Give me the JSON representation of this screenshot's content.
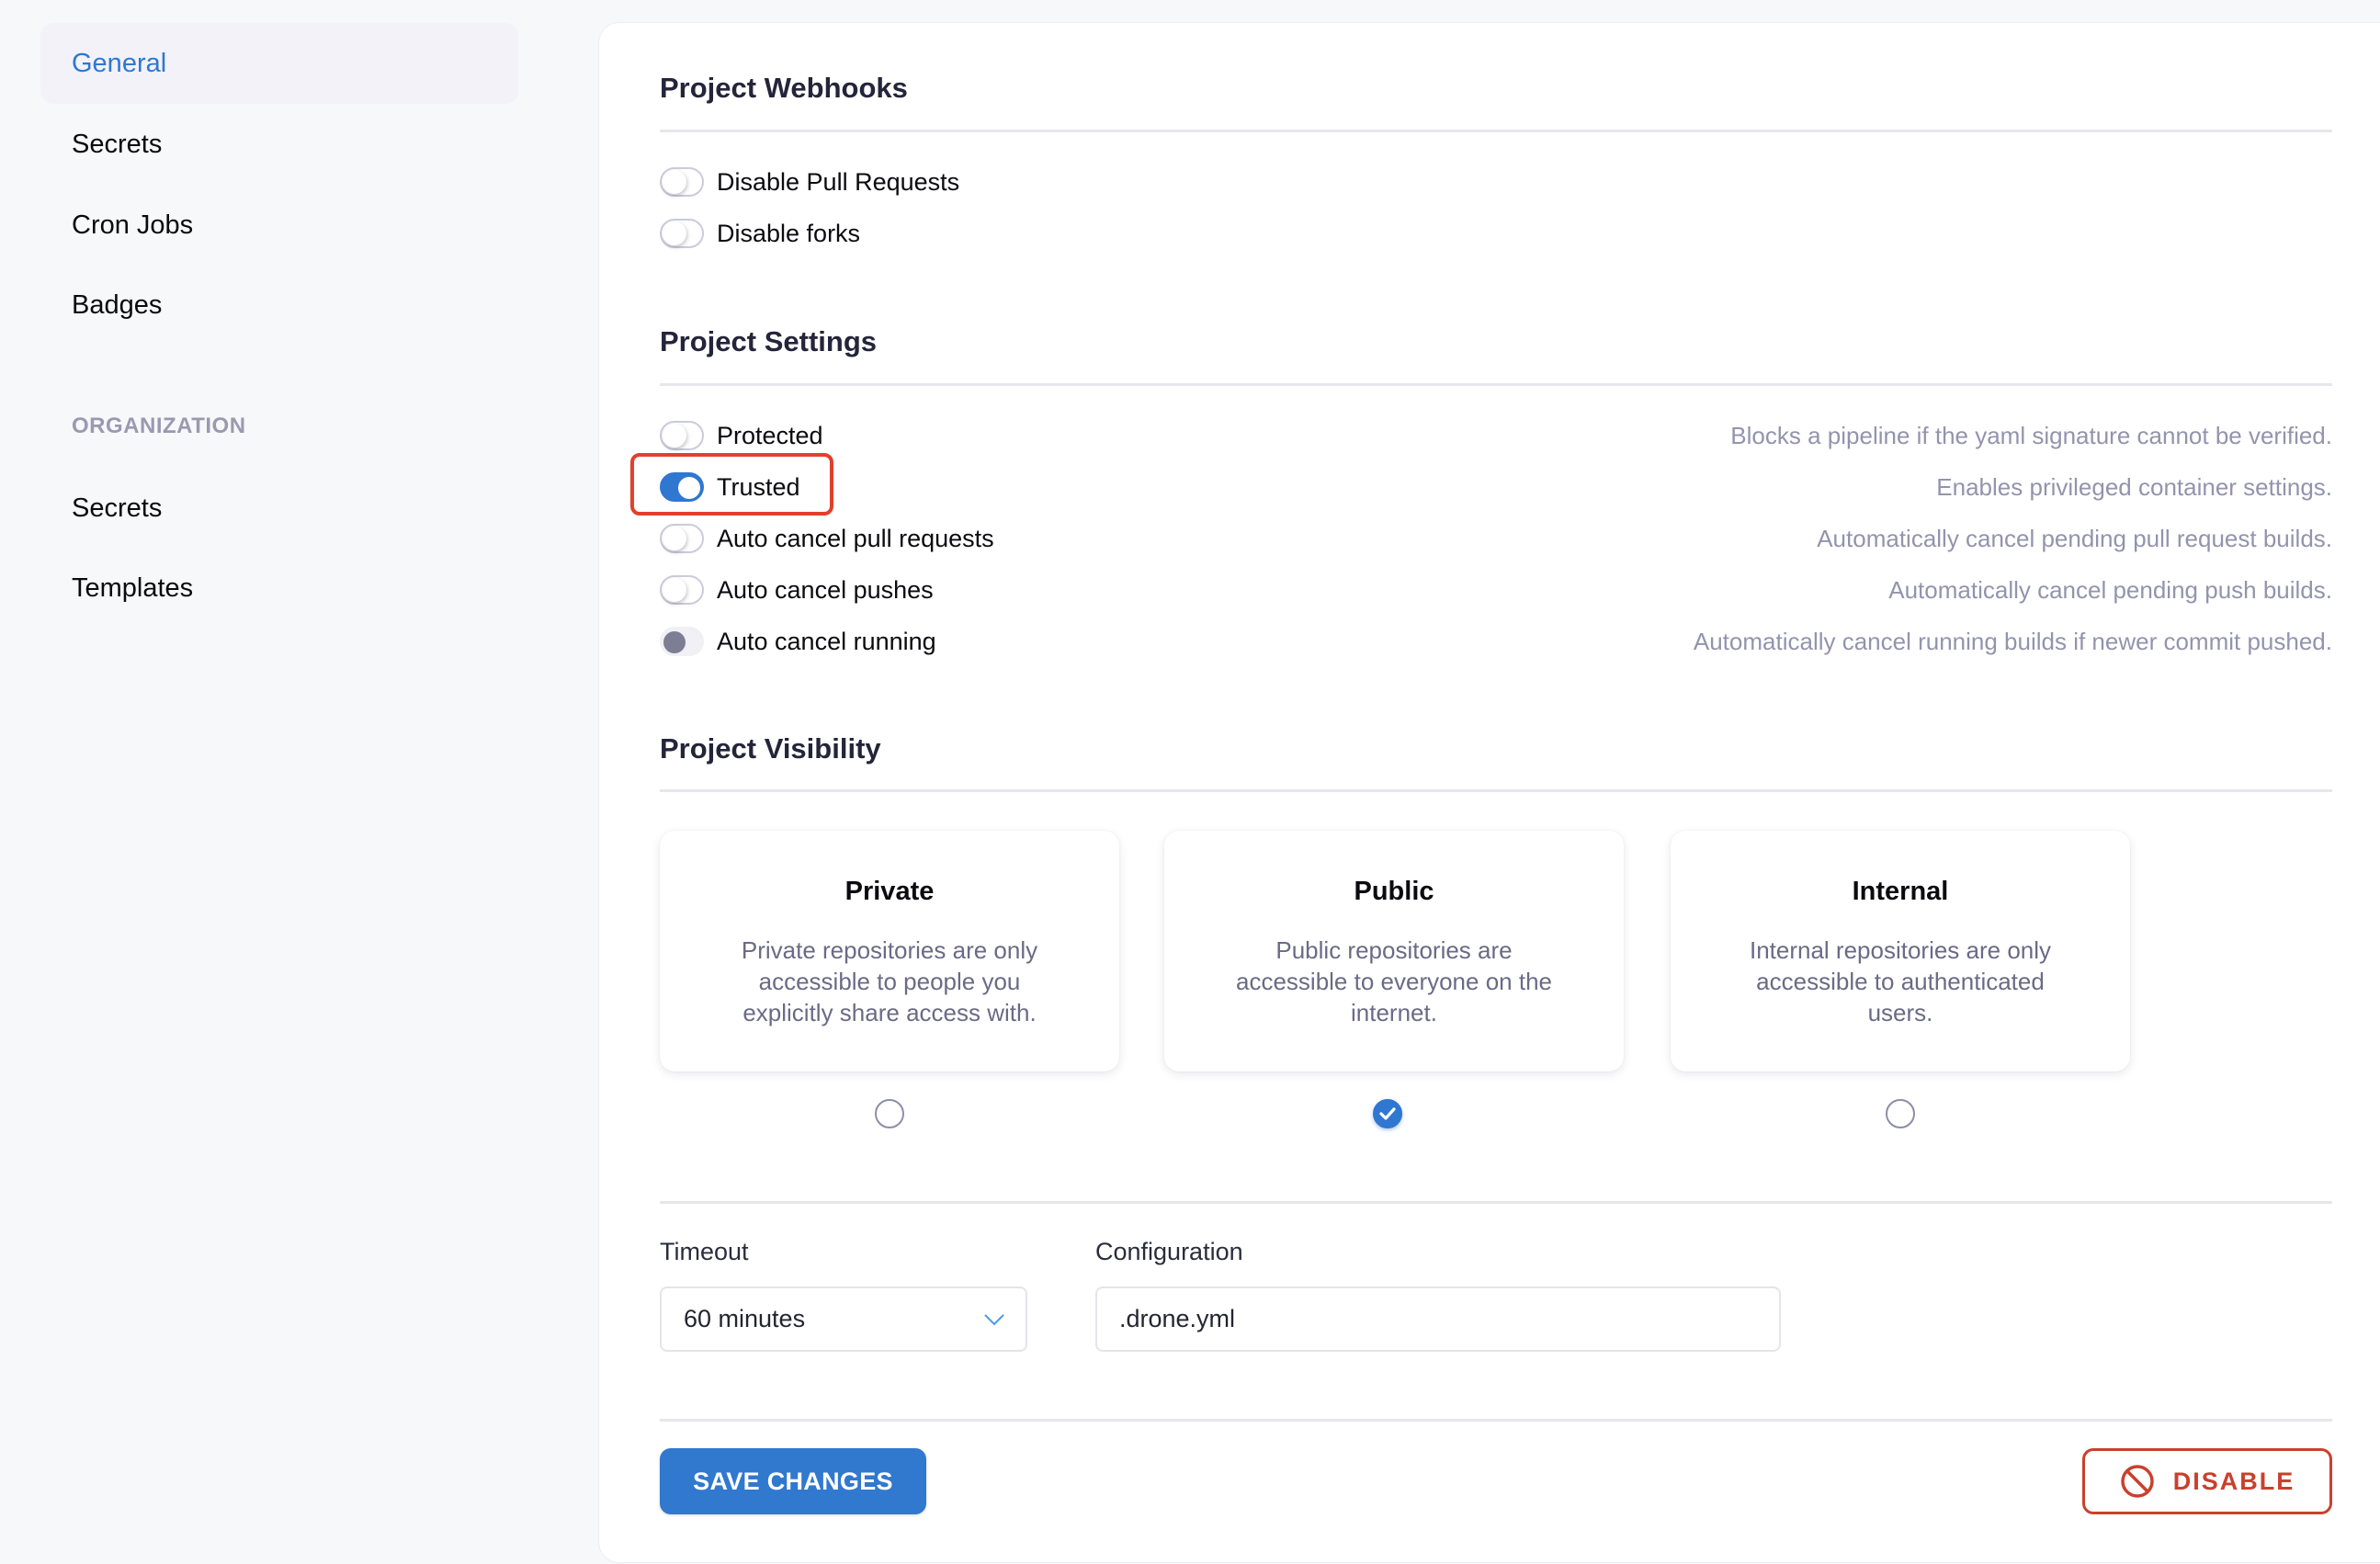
{
  "sidebar": {
    "items": [
      {
        "label": "General",
        "active": true
      },
      {
        "label": "Secrets"
      },
      {
        "label": "Cron Jobs"
      },
      {
        "label": "Badges"
      }
    ],
    "section_label": "ORGANIZATION",
    "org_items": [
      {
        "label": "Secrets"
      },
      {
        "label": "Templates"
      }
    ]
  },
  "webhooks": {
    "title": "Project Webhooks",
    "toggles": [
      {
        "label": "Disable Pull Requests",
        "on": false
      },
      {
        "label": "Disable forks",
        "on": false
      }
    ]
  },
  "settings": {
    "title": "Project Settings",
    "toggles": [
      {
        "label": "Protected",
        "on": false,
        "description": "Blocks a pipeline if the yaml signature cannot be verified."
      },
      {
        "label": "Trusted",
        "on": true,
        "highlighted": true,
        "description": "Enables privileged container settings."
      },
      {
        "label": "Auto cancel pull requests",
        "on": false,
        "description": "Automatically cancel pending pull request builds."
      },
      {
        "label": "Auto cancel pushes",
        "on": false,
        "description": "Automatically cancel pending push builds."
      },
      {
        "label": "Auto cancel running",
        "on": false,
        "description": "Automatically cancel running builds if newer commit pushed."
      }
    ]
  },
  "visibility": {
    "title": "Project Visibility",
    "options": [
      {
        "title": "Private",
        "description": "Private repositories are only accessible to people you explicitly share access with.",
        "selected": false
      },
      {
        "title": "Public",
        "description": "Public repositories are accessible to everyone on the internet.",
        "selected": true
      },
      {
        "title": "Internal",
        "description": "Internal repositories are only accessible to authenticated users.",
        "selected": false
      }
    ]
  },
  "form": {
    "timeout_label": "Timeout",
    "timeout_value": "60 minutes",
    "configuration_label": "Configuration",
    "configuration_value": ".drone.yml"
  },
  "actions": {
    "save_label": "SAVE CHANGES",
    "disable_label": "DISABLE"
  },
  "colors": {
    "accent": "#2f77d1",
    "danger": "#c9402d",
    "highlight": "#e2402b"
  }
}
